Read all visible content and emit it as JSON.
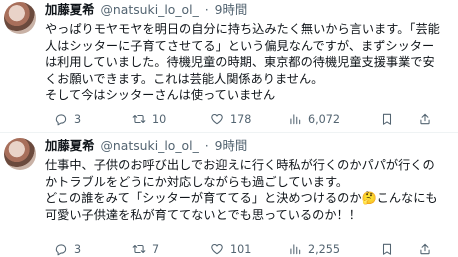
{
  "tweets": [
    {
      "author_name": "加藤夏希",
      "handle": "@natsuki_lo_ol_",
      "separator": "·",
      "time": "9時間",
      "text": "やっぱりモヤモヤを明日の自分に持ち込みたく無いから言います。「芸能人はシッターに子育てさせてる」という偏見なんですが、まずシッターは利用していました。待機児童の時期、東京都の待機児童支援事業で安くお願いできます。これは芸能人関係ありません。\nそして今はシッターさんは使っていません",
      "replies": "3",
      "reposts": "10",
      "likes": "178",
      "views": "6,072"
    },
    {
      "author_name": "加藤夏希",
      "handle": "@natsuki_lo_ol_",
      "separator": "·",
      "time": "9時間",
      "text": "仕事中、子供のお呼び出しでお迎えに行く時私が行くのかパパが行くのかトラブルをどうにか対応しながらも過ごしています。\nどこの誰をみて「シッターが育ててる」と決めつけるのか🤔こんなにも可愛い子供達を私が育ててないとでも思っているのか！！",
      "replies": "3",
      "reposts": "7",
      "likes": "101",
      "views": "2,255"
    }
  ],
  "icons": {
    "reply": "speech-bubble-icon",
    "repost": "repost-arrows-icon",
    "like": "heart-icon",
    "views": "bar-chart-icon",
    "bookmark": "bookmark-icon",
    "share": "share-icon"
  },
  "colors": {
    "text": "#0f1419",
    "secondary": "#536471",
    "divider": "#eff3f4"
  }
}
